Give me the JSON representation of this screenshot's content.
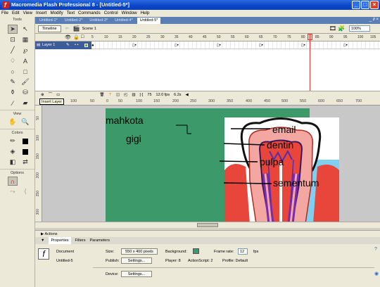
{
  "window": {
    "title": "Macromedia Flash Professional 8 - [Untitled-5*]",
    "btn_min": "_",
    "btn_max": "□",
    "btn_close": "×"
  },
  "menu": [
    "File",
    "Edit",
    "View",
    "Insert",
    "Modify",
    "Text",
    "Commands",
    "Control",
    "Window",
    "Help"
  ],
  "tools": {
    "title": "Tools",
    "view_label": "View",
    "colors_label": "Colors",
    "options_label": "Options"
  },
  "doc_tabs": [
    "Untitled-1*",
    "Untitled-2*",
    "Untitled-3*",
    "Untitled-4*",
    "Untitled-5*"
  ],
  "doc_controls": "_ ∂ ×",
  "editbar": {
    "timeline_button": "Timeline",
    "scene": "Scene 1",
    "zoom": "100%"
  },
  "timeline": {
    "layer_name": "Layer 1",
    "ruler": [
      "5",
      "10",
      "15",
      "20",
      "25",
      "30",
      "35",
      "40",
      "45",
      "50",
      "55",
      "60",
      "65",
      "70",
      "75",
      "80",
      "85",
      "90",
      "95",
      "100",
      "105"
    ],
    "current_frame": "75",
    "fps": "12.0 fps",
    "time": "6.2s"
  },
  "tooltip": "Insert Layer",
  "ruler_h": [
    "100",
    "50",
    "0",
    "50",
    "100",
    "150",
    "200",
    "250",
    "300",
    "350",
    "400",
    "450",
    "500",
    "550",
    "600",
    "650",
    "700"
  ],
  "ruler_v": [
    "50",
    "100",
    "150",
    "200",
    "250",
    "300"
  ],
  "diagram": {
    "labels": {
      "mahkota": "mahkota",
      "gigi": "gigi",
      "email": "email",
      "dentin": "dentin",
      "pulpa": "pulpa",
      "sementum": "sementum"
    },
    "colors": {
      "stage": "#3c9a6a",
      "gum": "#e8463a",
      "enamel": "#ffffff",
      "dentin": "#f4a6a0",
      "pulp": "#8a3fc0",
      "root_bg": "#7fd0f0"
    }
  },
  "actions_label": "Actions",
  "props_tabs": [
    "Properties",
    "Filters",
    "Parameters"
  ],
  "properties": {
    "doc_label": "Document",
    "doc_name": "Untitled-5",
    "size_label": "Size:",
    "size_value": "550 x 400 pixels",
    "background_label": "Background:",
    "background_color": "#3c9a6a",
    "framerate_label": "Frame rate:",
    "framerate_value": "12",
    "fps_unit": "fps",
    "publish_label": "Publish:",
    "settings_button": "Settings...",
    "player_text": "Player: 8",
    "actionscript_text": "ActionScript: 2",
    "profile_text": "Profile: Default",
    "device_label": "Device:",
    "device_settings_button": "Settings..."
  }
}
